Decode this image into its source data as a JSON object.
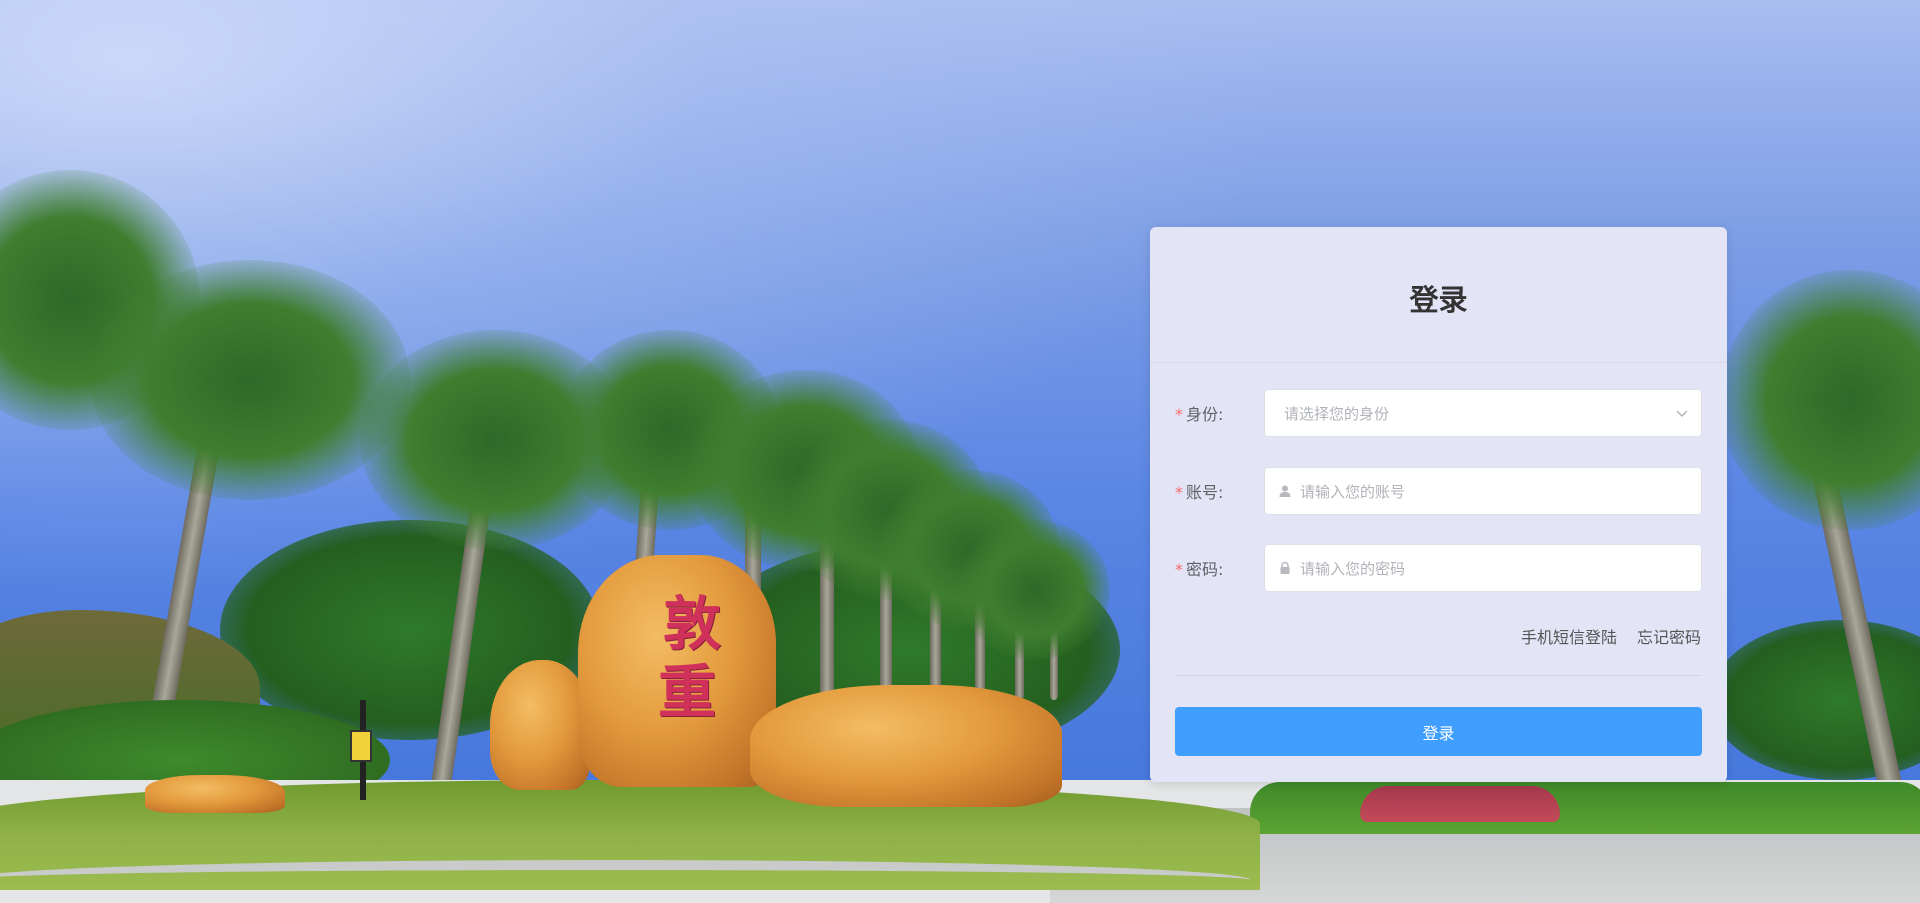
{
  "background": {
    "carved_text": [
      "敦",
      "重"
    ]
  },
  "login": {
    "title": "登录",
    "required_mark": "*",
    "identity": {
      "label": "身份:",
      "placeholder": "请选择您的身份"
    },
    "account": {
      "label": "账号:",
      "placeholder": "请输入您的账号"
    },
    "password": {
      "label": "密码:",
      "placeholder": "请输入您的密码"
    },
    "links": {
      "sms_login": "手机短信登陆",
      "forgot_password": "忘记密码"
    },
    "submit_label": "登录"
  },
  "colors": {
    "primary": "#409eff",
    "card_bg": "#e4e4f7",
    "required": "#f56c6c"
  },
  "icons": {
    "identity_suffix": "chevron-down-icon",
    "account_prefix": "user-icon",
    "password_prefix": "lock-icon"
  }
}
